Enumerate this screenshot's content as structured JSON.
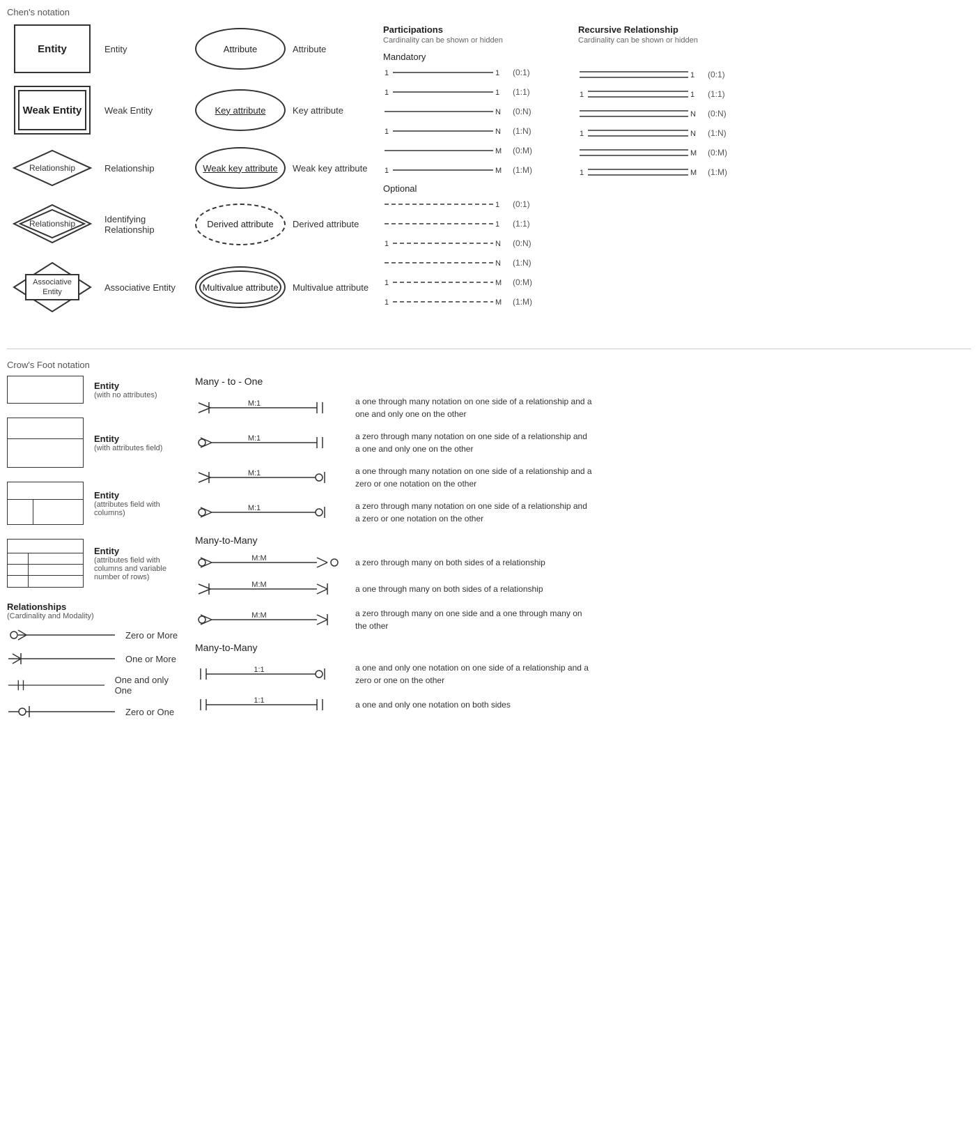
{
  "chens": {
    "section_title": "Chen's notation",
    "rows": [
      {
        "id": "entity",
        "shape_label": "Entity",
        "description": "Entity",
        "attr_shape": "Attribute",
        "attr_label": "Attribute"
      },
      {
        "id": "weak_entity",
        "shape_label": "Weak Entity",
        "description": "Weak Entity",
        "attr_shape": "Key attribute",
        "attr_label": "Key attribute"
      },
      {
        "id": "relationship",
        "shape_label": "Relationship",
        "description": "Relationship",
        "attr_shape": "Weak key attribute",
        "attr_label": "Weak key attribute"
      },
      {
        "id": "identifying_rel",
        "shape_label": "Relationship",
        "description": "Identifying Relationship",
        "attr_shape": "Derived attribute",
        "attr_label": "Derived attribute"
      },
      {
        "id": "associative",
        "shape_label": "Associative Entity",
        "description": "Associative Entity",
        "attr_shape": "Multivalue attribute",
        "attr_label": "Multivalue attribute"
      }
    ]
  },
  "participations": {
    "title": "Participations",
    "subtitle": "Cardinality can be shown or hidden",
    "mandatory_title": "Mandatory",
    "optional_title": "Optional",
    "mandatory_rows": [
      {
        "left": "1",
        "right": "1",
        "notation": "(0:1)"
      },
      {
        "left": "1",
        "right": "1",
        "notation": "(1:1)"
      },
      {
        "left": "",
        "right": "N",
        "notation": "(0:N)"
      },
      {
        "left": "1",
        "right": "N",
        "notation": "(1:N)"
      },
      {
        "left": "",
        "right": "M",
        "notation": "(0:M)"
      },
      {
        "left": "1",
        "right": "M",
        "notation": "(1:M)"
      }
    ],
    "optional_rows": [
      {
        "left": "",
        "right": "1",
        "notation": "(0:1)"
      },
      {
        "left": "",
        "right": "1",
        "notation": "(1:1)"
      },
      {
        "left": "1",
        "right": "N",
        "notation": "(0:N)"
      },
      {
        "left": "",
        "right": "N",
        "notation": "(1:N)"
      },
      {
        "left": "1",
        "right": "M",
        "notation": "(0:M)"
      },
      {
        "left": "1",
        "right": "M",
        "notation": "(1:M)"
      }
    ]
  },
  "recursive": {
    "title": "Recursive Relationship",
    "subtitle": "Cardinality can be shown or hidden",
    "rows": [
      {
        "left": "",
        "right": "1",
        "notation": "(0:1)"
      },
      {
        "left": "1",
        "right": "1",
        "notation": "(1:1)"
      },
      {
        "left": "",
        "right": "N",
        "notation": "(0:N)"
      },
      {
        "left": "1",
        "right": "N",
        "notation": "(1:N)"
      },
      {
        "left": "",
        "right": "M",
        "notation": "(0:M)"
      },
      {
        "left": "1",
        "right": "M",
        "notation": "(1:M)"
      }
    ]
  },
  "crows": {
    "section_title": "Crow's Foot notation",
    "entities": [
      {
        "id": "simple",
        "label": "Entity",
        "sublabel": "(with no attributes)"
      },
      {
        "id": "attr",
        "label": "Entity",
        "sublabel": "(with attributes field)"
      },
      {
        "id": "cols",
        "label": "Entity",
        "sublabel": "(attributes field with columns)"
      },
      {
        "id": "rows",
        "label": "Entity",
        "sublabel": "(attributes field with columns and variable number of rows)"
      }
    ],
    "many_to_one_title": "Many - to - One",
    "many_to_one_rows": [
      {
        "label": "M:1",
        "desc": "a one through many notation on one side of a relationship and a one and only one on the other",
        "left_sym": "many_one",
        "right_sym": "one_only"
      },
      {
        "label": "M:1",
        "desc": "a zero through many notation on one side of a relationship and a one and only one on the other",
        "left_sym": "zero_many",
        "right_sym": "one_only"
      },
      {
        "label": "M:1",
        "desc": "a one through many notation on one side of a relationship and a zero or one notation on the other",
        "left_sym": "many_one",
        "right_sym": "zero_one"
      },
      {
        "label": "M:1",
        "desc": "a zero through many notation on one side of a relationship and a zero or one notation on the other",
        "left_sym": "zero_many",
        "right_sym": "zero_one"
      }
    ],
    "many_to_many_title": "Many-to-Many",
    "many_to_many_rows": [
      {
        "label": "M:M",
        "desc": "a zero through many on both sides of a relationship",
        "left_sym": "zero_many",
        "right_sym": "zero_many_r"
      },
      {
        "label": "M:M",
        "desc": "a one through many on both sides of a relationship",
        "left_sym": "many_one",
        "right_sym": "many_r"
      },
      {
        "label": "M:M",
        "desc": "a zero through many on one side and a one through many on the other",
        "left_sym": "zero_many",
        "right_sym": "many_r"
      }
    ],
    "many_to_many2_title": "Many-to-Many",
    "one_to_one_rows": [
      {
        "label": "1:1",
        "desc": "a one and only one notation on one side of a relationship and a zero or one on the other",
        "left_sym": "one_only",
        "right_sym": "zero_one"
      },
      {
        "label": "1:1",
        "desc": "a one and only one notation on both sides",
        "left_sym": "one_only",
        "right_sym": "one_only"
      }
    ],
    "relationships_title": "Relationships",
    "relationships_subtitle": "(Cardinality and Modality)",
    "rel_rows": [
      {
        "id": "zero_more",
        "label": "Zero or More"
      },
      {
        "id": "one_more",
        "label": "One or More"
      },
      {
        "id": "one_only",
        "label": "One and only One"
      },
      {
        "id": "zero_one",
        "label": "Zero or One"
      }
    ]
  }
}
